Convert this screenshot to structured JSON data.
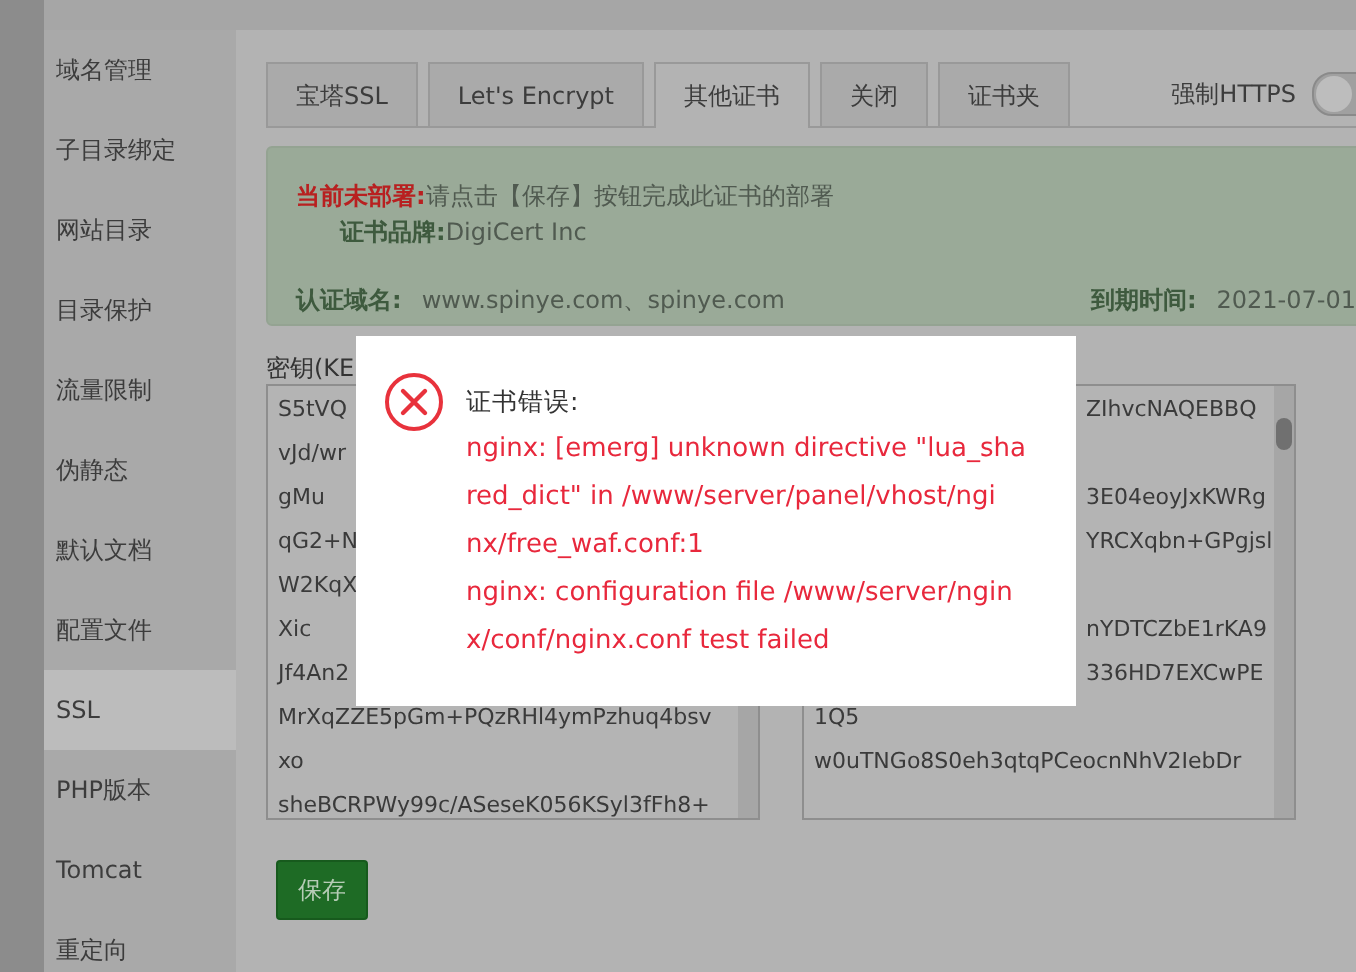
{
  "sidebar": {
    "items": [
      {
        "label": "域名管理",
        "selected": false
      },
      {
        "label": "子目录绑定",
        "selected": false
      },
      {
        "label": "网站目录",
        "selected": false
      },
      {
        "label": "目录保护",
        "selected": false
      },
      {
        "label": "流量限制",
        "selected": false
      },
      {
        "label": "伪静态",
        "selected": false
      },
      {
        "label": "默认文档",
        "selected": false
      },
      {
        "label": "配置文件",
        "selected": false
      },
      {
        "label": "SSL",
        "selected": true
      },
      {
        "label": "PHP版本",
        "selected": false
      },
      {
        "label": "Tomcat",
        "selected": false
      },
      {
        "label": "重定向",
        "selected": false
      }
    ]
  },
  "tabs": [
    {
      "label": "宝塔SSL",
      "selected": false
    },
    {
      "label": "Let's Encrypt",
      "selected": false
    },
    {
      "label": "其他证书",
      "selected": true
    },
    {
      "label": "关闭",
      "selected": false
    },
    {
      "label": "证书夹",
      "selected": false
    }
  ],
  "force_https": {
    "label": "强制HTTPS",
    "on": false
  },
  "notice": {
    "status_label": "当前未部署:",
    "status_text": "请点击【保存】按钮完成此证书的部署",
    "brand_label": "证书品牌:",
    "brand": "DigiCert Inc",
    "domain_label": "认证域名:",
    "domains": "www.spinye.com、spinye.com",
    "expiry_label": "到期时间:",
    "expiry": "2021-07-01"
  },
  "key_field": {
    "label": "密钥(KE",
    "lines": [
      "S5tVQ",
      "vJd/wr",
      "gMu",
      "qG2+N",
      "W2KqX",
      "Xic",
      "Jf4An2",
      "MrXqZZE5pGm+PQzRHl4ymPzhuq4bsv",
      "xo",
      "sheBCRPWy99c/ASeseK056KSyl3fFh8+"
    ]
  },
  "cert_field": {
    "lines": [
      {
        "text": "ZIhvcNAQEBBQ",
        "kind": "tail"
      },
      {
        "kind": "blank"
      },
      {
        "text": "3E04eoyJxKWRg",
        "kind": "tail"
      },
      {
        "text": "YRCXqbn+GPgjsl",
        "kind": "tail"
      },
      {
        "kind": "blank"
      },
      {
        "text": "nYDTCZbE1rKA9",
        "kind": "tail"
      },
      {
        "text": "336HD7EXCwPE",
        "kind": "tail"
      },
      {
        "text": "1Q5",
        "kind": "full"
      },
      {
        "text": "w0uTNGo8S0eh3qtqPCeocnNhV2IebDr",
        "kind": "full"
      }
    ]
  },
  "save_button": {
    "label": "保存"
  },
  "error_dialog": {
    "title": "证书错误:",
    "lines": [
      "nginx: [emerg] unknown directive \"lua_sha",
      "red_dict\" in /www/server/panel/vhost/ngi",
      "nx/free_waf.conf:1",
      "nginx: configuration file /www/server/ngin",
      "x/conf/nginx.conf test failed"
    ]
  }
}
